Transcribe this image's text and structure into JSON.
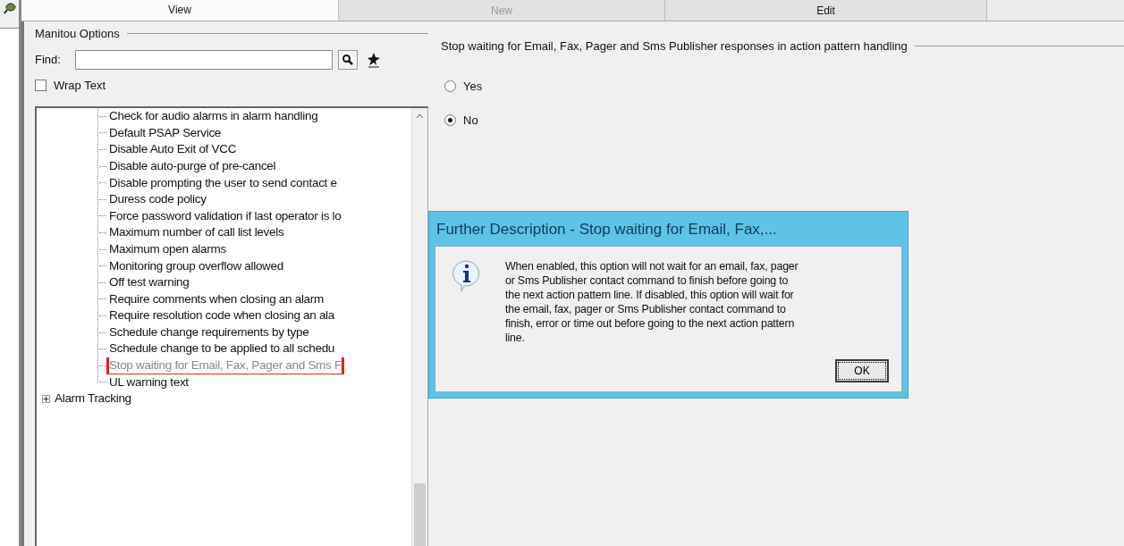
{
  "toolbar": {
    "tabs": [
      {
        "label": "View",
        "selected": true,
        "disabled": false
      },
      {
        "label": "New",
        "selected": false,
        "disabled": true
      },
      {
        "label": "Edit",
        "selected": false,
        "disabled": false
      }
    ]
  },
  "options_panel": {
    "title": "Manitou Options",
    "find": {
      "label": "Find:"
    },
    "wrap_text": {
      "label": "Wrap Text",
      "checked": false
    }
  },
  "tree": {
    "nodes": [
      {
        "children": [
          {
            "label": "Check for audio alarms in alarm handling",
            "selected": false
          },
          {
            "label": "Default PSAP Service",
            "selected": false
          },
          {
            "label": "Disable Auto Exit of VCC",
            "selected": false
          },
          {
            "label": "Disable auto-purge of pre-cancel",
            "selected": false
          },
          {
            "label": "Disable prompting the user to send contact e",
            "selected": false
          },
          {
            "label": "Duress code policy",
            "selected": false
          },
          {
            "label": "Force password validation if last operator is lo",
            "selected": false
          },
          {
            "label": "Maximum number of call list levels",
            "selected": false
          },
          {
            "label": "Maximum open alarms",
            "selected": false
          },
          {
            "label": "Monitoring group overflow allowed",
            "selected": false
          },
          {
            "label": "Off test warning",
            "selected": false
          },
          {
            "label": "Require comments when closing an alarm",
            "selected": false
          },
          {
            "label": "Require resolution code when closing an ala",
            "selected": false
          },
          {
            "label": "Schedule change requirements by type",
            "selected": false
          },
          {
            "label": "Schedule change to be applied to all schedu",
            "selected": false
          },
          {
            "label": "Stop waiting for Email, Fax, Pager and Sms F",
            "selected": true
          },
          {
            "label": "UL warning text",
            "selected": false
          }
        ]
      },
      {
        "label": "Alarm Tracking",
        "expanded": false
      }
    ]
  },
  "option": {
    "title": "Stop waiting for Email, Fax, Pager and Sms Publisher responses in action pattern handling",
    "choices": [
      {
        "label": "Yes",
        "selected": false
      },
      {
        "label": "No",
        "selected": true
      }
    ]
  },
  "dialog": {
    "title": "Further Description - Stop waiting for Email, Fax,...",
    "message": "When enabled, this option will not wait for an email, fax, pager or Sms Publisher contact command to finish before going to the next action pattern line. If disabled, this option will wait for the email, fax, pager or Sms Publisher contact command to finish, error or time out before going to the next action pattern line.",
    "button": "OK"
  }
}
